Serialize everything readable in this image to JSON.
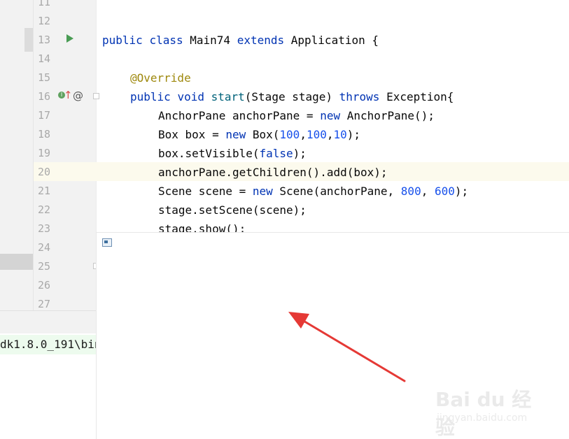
{
  "editor": {
    "line_numbers": [
      "11",
      "12",
      "13",
      "14",
      "15",
      "16",
      "17",
      "18",
      "19",
      "20",
      "21",
      "22",
      "23",
      "24",
      "25",
      "26",
      "27"
    ],
    "code": {
      "l13": {
        "kw1": "public",
        "kw2": "class",
        "name": "Main74",
        "kw3": "extends",
        "rest": "Application {"
      },
      "l15": {
        "annotation": "@Override"
      },
      "l16": {
        "kw1": "public",
        "kw2": "void",
        "fn": "start",
        "p1": "(Stage stage) ",
        "kw3": "throws",
        "p2": " Exception{"
      },
      "l17": {
        "p1": "AnchorPane anchorPane = ",
        "kw": "new",
        "p2": " AnchorPane();"
      },
      "l18": {
        "p1": "Box box = ",
        "kw": "new",
        "p2": " Box(",
        "n1": "100",
        "c1": ",",
        "n2": "100",
        "c2": ",",
        "n3": "10",
        "p3": ");"
      },
      "l19": {
        "p1": "box.setVisible(",
        "kw": "false",
        "p2": ");"
      },
      "l20": {
        "text": "anchorPane.getChildren().add(box);"
      },
      "l21": {
        "p1": "Scene scene = ",
        "kw": "new",
        "p2": " Scene(anchorPane, ",
        "n1": "800",
        "c1": ", ",
        "n2": "600",
        "p3": ");"
      },
      "l22": {
        "text": "stage.setScene(scene);"
      },
      "l23": {
        "text": "stage.show();"
      }
    }
  },
  "gutter": {
    "impl_badge": "I",
    "override_arrow": "↑",
    "at_symbol": "@"
  },
  "console": {
    "path_fragment": "dk1.8.0_191\\bin"
  },
  "watermark": {
    "logo": "Bai du 经验",
    "sub": "jingyan.baidu.com"
  },
  "colors": {
    "keyword": "#0033b3",
    "annotation": "#9e880d",
    "number": "#1750eb",
    "method": "#00627a",
    "arrow": "#e53935"
  }
}
